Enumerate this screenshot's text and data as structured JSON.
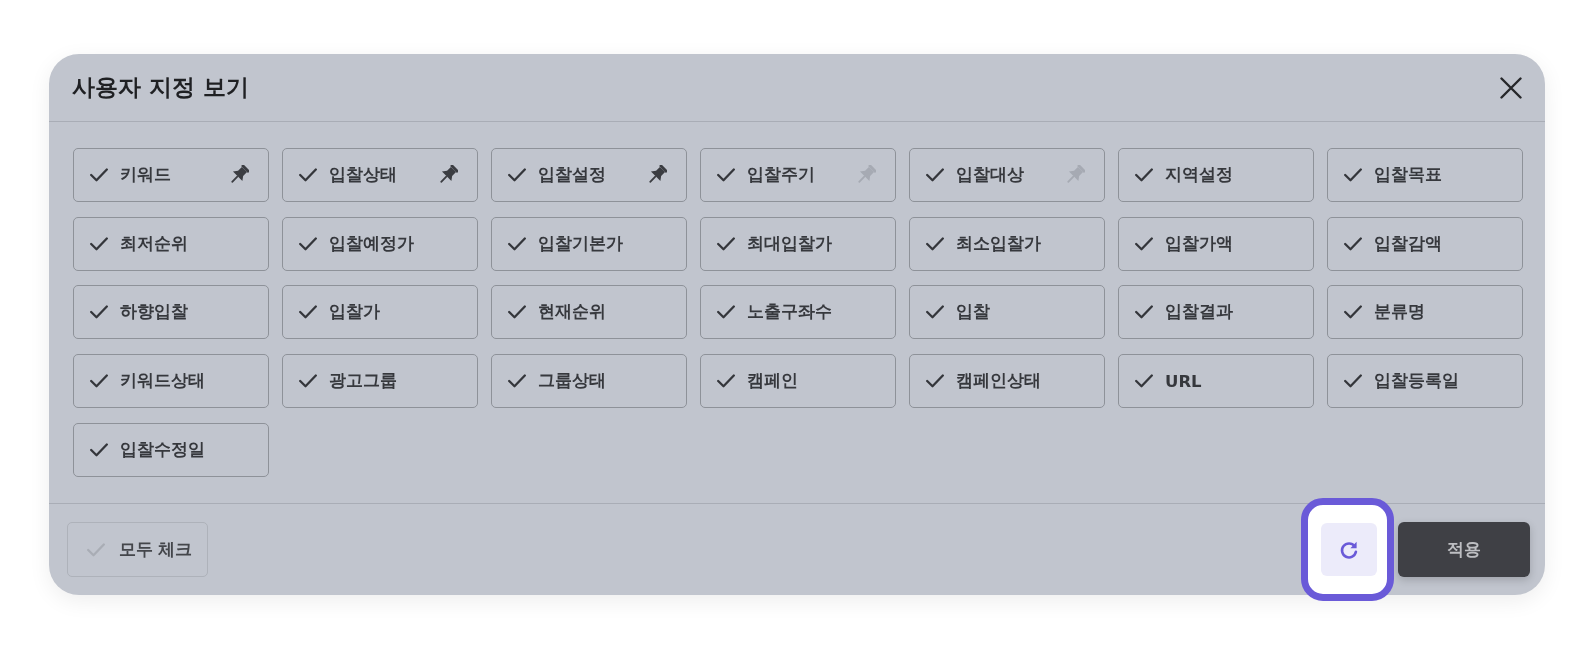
{
  "dialog": {
    "title": "사용자 지정 보기",
    "columns": [
      {
        "label": "키워드",
        "checked": true,
        "pinned": true
      },
      {
        "label": "입찰상태",
        "checked": true,
        "pinned": true
      },
      {
        "label": "입찰설정",
        "checked": true,
        "pinned": true
      },
      {
        "label": "입찰주기",
        "checked": true,
        "pinned": false
      },
      {
        "label": "입찰대상",
        "checked": true,
        "pinned": false
      },
      {
        "label": "지역설정",
        "checked": true
      },
      {
        "label": "입찰목표",
        "checked": true
      },
      {
        "label": "최저순위",
        "checked": true
      },
      {
        "label": "입찰예정가",
        "checked": true
      },
      {
        "label": "입찰기본가",
        "checked": true
      },
      {
        "label": "최대입찰가",
        "checked": true
      },
      {
        "label": "최소입찰가",
        "checked": true
      },
      {
        "label": "입찰가액",
        "checked": true
      },
      {
        "label": "입찰감액",
        "checked": true
      },
      {
        "label": "하향입찰",
        "checked": true
      },
      {
        "label": "입찰가",
        "checked": true
      },
      {
        "label": "현재순위",
        "checked": true
      },
      {
        "label": "노출구좌수",
        "checked": true
      },
      {
        "label": "입찰",
        "checked": true
      },
      {
        "label": "입찰결과",
        "checked": true
      },
      {
        "label": "분류명",
        "checked": true
      },
      {
        "label": "키워드상태",
        "checked": true
      },
      {
        "label": "광고그룹",
        "checked": true
      },
      {
        "label": "그룹상태",
        "checked": true
      },
      {
        "label": "캠페인",
        "checked": true
      },
      {
        "label": "캠페인상태",
        "checked": true
      },
      {
        "label": "URL",
        "checked": true
      },
      {
        "label": "입찰등록일",
        "checked": true
      },
      {
        "label": "입찰수정일",
        "checked": true
      }
    ],
    "footer": {
      "check_all": {
        "label": "모두 체크",
        "checked": false
      },
      "refresh": {
        "highlighted": true
      },
      "apply": {
        "label": "적용"
      }
    }
  }
}
